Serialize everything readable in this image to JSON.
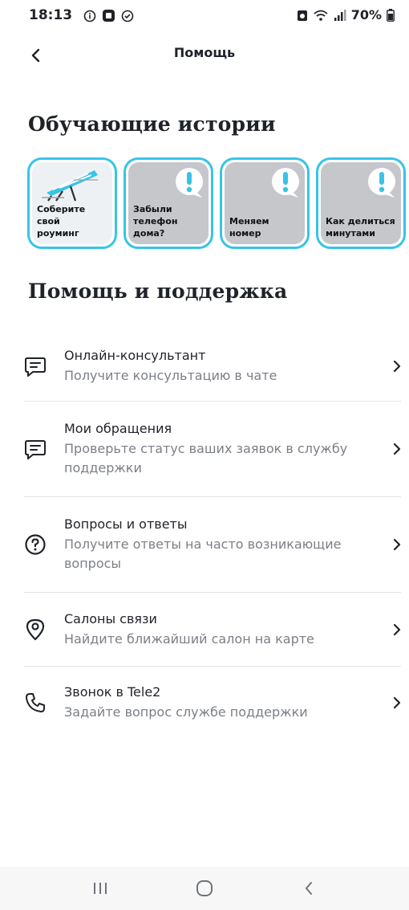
{
  "status_bar": {
    "time": "18:13",
    "battery": "70%",
    "icons_left": [
      "info-icon",
      "app-icon",
      "shield-icon"
    ],
    "icons_right": [
      "alarm-icon",
      "wifi-icon",
      "signal-icon",
      "battery-icon"
    ]
  },
  "header": {
    "title": "Помощь",
    "back_icon": "back-arrow-icon"
  },
  "stories": {
    "title": "Обучающие истории",
    "accent_color": "#37c4e6",
    "items": [
      {
        "label_lines": [
          "Соберите",
          "свой",
          "роуминг"
        ],
        "icon": "beach-chair-icon"
      },
      {
        "label_lines": [
          "Забыли",
          "телефон",
          "дома?"
        ],
        "icon": "exclamation-bubble-icon"
      },
      {
        "label_lines": [
          "Меняем",
          "номер"
        ],
        "icon": "exclamation-bubble-icon"
      },
      {
        "label_lines": [
          "Как делиться",
          "минутами"
        ],
        "icon": "exclamation-bubble-icon"
      }
    ]
  },
  "support": {
    "title": "Помощь и поддержка",
    "items": [
      {
        "title": "Онлайн-консультант",
        "subtitle": "Получите консультацию в чате",
        "icon": "chat-icon"
      },
      {
        "title": "Мои обращения",
        "subtitle": "Проверьте статус ваших заявок в службу поддержки",
        "icon": "chat-icon"
      },
      {
        "title": "Вопросы и ответы",
        "subtitle": "Получите ответы на часто возникающие вопросы",
        "icon": "question-circle-icon"
      },
      {
        "title": "Салоны связи",
        "subtitle": "Найдите ближайший салон на карте",
        "icon": "location-pin-icon"
      },
      {
        "title": "Звонок в Tele2",
        "subtitle": "Задайте вопрос службе поддержки",
        "icon": "phone-icon"
      }
    ]
  },
  "nav": {
    "buttons": [
      "recents-icon",
      "home-icon",
      "back-icon"
    ]
  }
}
